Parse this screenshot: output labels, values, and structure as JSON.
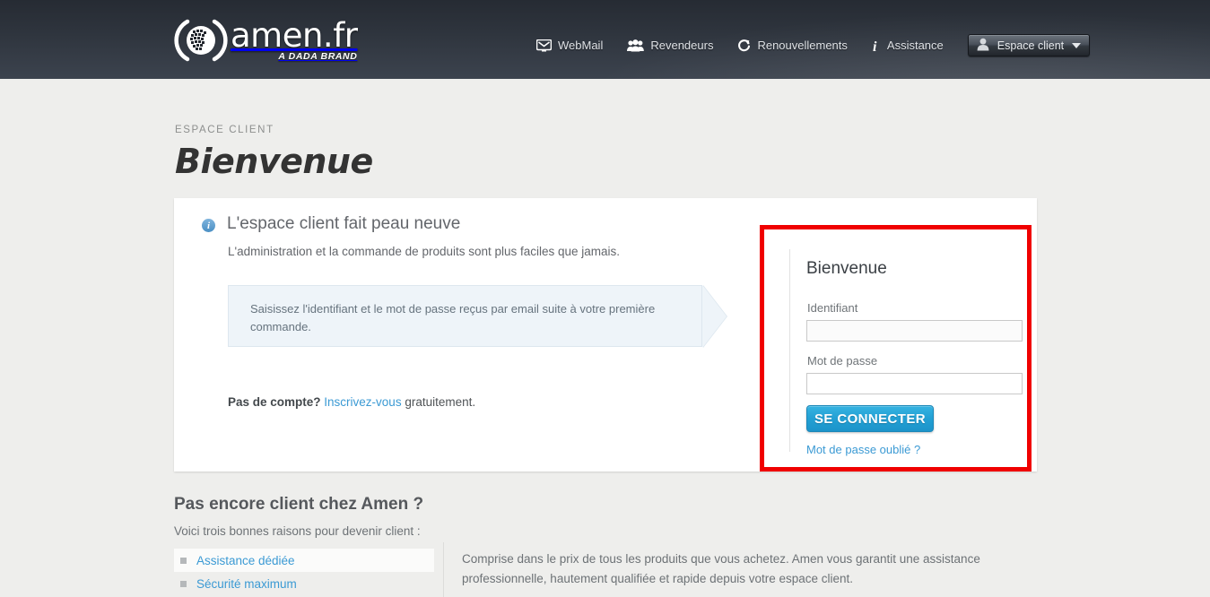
{
  "header": {
    "logo": {
      "name": "amen.fr",
      "tagline": "A DADA BRAND",
      "mark": "amen-sphere-logo"
    },
    "nav": [
      {
        "label": "WebMail",
        "icon": "envelope-icon"
      },
      {
        "label": "Revendeurs",
        "icon": "people-icon"
      },
      {
        "label": "Renouvellements",
        "icon": "refresh-icon"
      },
      {
        "label": "Assistance",
        "icon": "info-italic-icon"
      }
    ],
    "client_button": {
      "label": "Espace client",
      "icon": "user-icon",
      "caret": "chevron-down-icon"
    }
  },
  "page": {
    "breadcrumb": "ESPACE CLIENT",
    "title": "Bienvenue"
  },
  "info": {
    "icon": "info-circle-icon",
    "title": "L'espace client fait peau neuve",
    "subtitle": "L'administration et la commande de produits sont plus faciles que jamais.",
    "callout": "Saisissez l'identifiant et le mot de passe reçus par email suite à votre première commande.",
    "signup_prefix": "Pas de compte?",
    "signup_link": "Inscrivez-vous",
    "signup_suffix": "gratuitement."
  },
  "login": {
    "title": "Bienvenue",
    "identifier_label": "Identifiant",
    "identifier_value": "",
    "identifier_placeholder": "",
    "password_label": "Mot de passe",
    "password_value": "",
    "password_placeholder": "",
    "submit_label": "SE CONNECTER",
    "forgot_label": "Mot de passe oublié ?",
    "highlight_color": "#f00000"
  },
  "bottom": {
    "title": "Pas encore client chez Amen ?",
    "subtitle": "Voici trois bonnes raisons pour devenir client :",
    "reasons": [
      {
        "label": "Assistance dédiée",
        "active": true
      },
      {
        "label": "Sécurité maximum",
        "active": false
      }
    ],
    "paragraph": "Comprise dans le prix de tous les produits que vous achetez. Amen vous garantit une assistance professionnelle, hautement qualifiée et rapide depuis votre espace client."
  }
}
